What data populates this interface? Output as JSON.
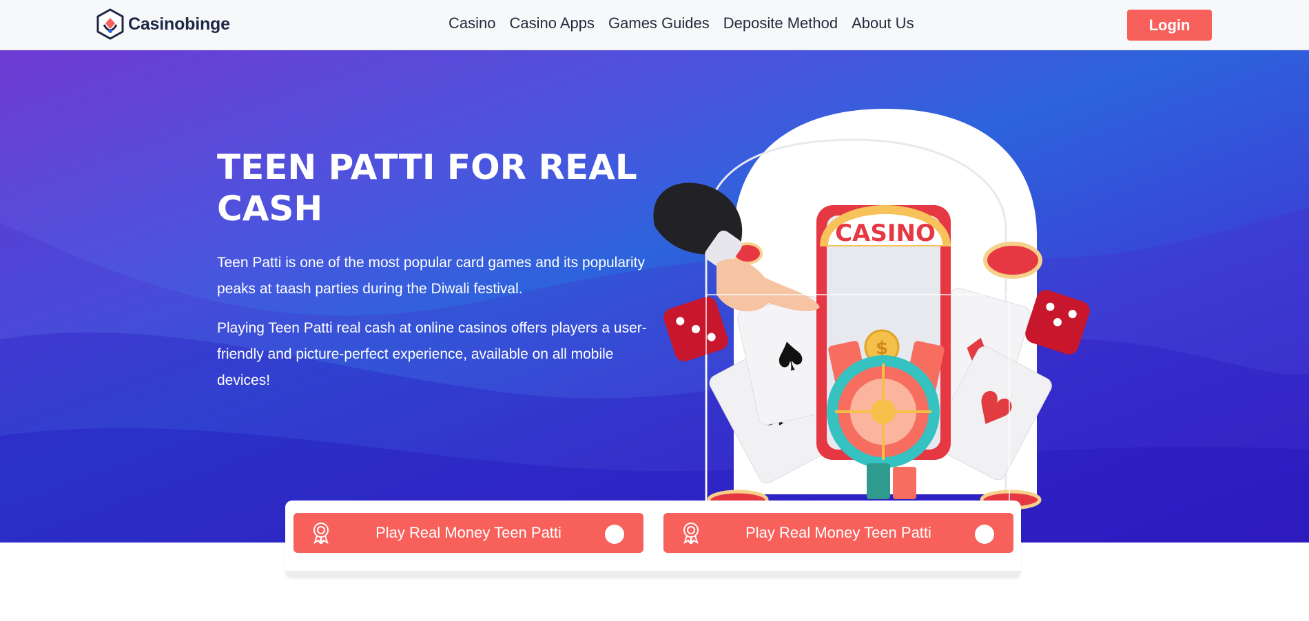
{
  "brand": {
    "name": "Casinobinge",
    "accent": "#f7605b",
    "hero_gradient": [
      "#6f3bd3",
      "#2d63dc",
      "#3523c6"
    ]
  },
  "nav": {
    "items": [
      {
        "label": "Casino"
      },
      {
        "label": "Casino Apps"
      },
      {
        "label": "Games Guides"
      },
      {
        "label": "Deposite Method"
      },
      {
        "label": "About Us"
      }
    ],
    "login_label": "Login"
  },
  "hero": {
    "title": "TEEN PATTI FOR REAL CASH",
    "paragraphs": [
      "Teen Patti is one of the most popular card games and its popularity peaks at taash parties during the Diwali festival.",
      "Playing Teen Patti real cash at online casinos offers players a user-friendly and picture-perfect experience, available on all mobile devices!"
    ],
    "illustration": {
      "icon": "casino-phone-illustration",
      "sign_text": "CASINO"
    }
  },
  "cta": [
    {
      "label": "Play Real Money Teen Patti",
      "icon": "award-ribbon-icon"
    },
    {
      "label": "Play Real Money Teen Patti",
      "icon": "award-ribbon-icon"
    }
  ]
}
